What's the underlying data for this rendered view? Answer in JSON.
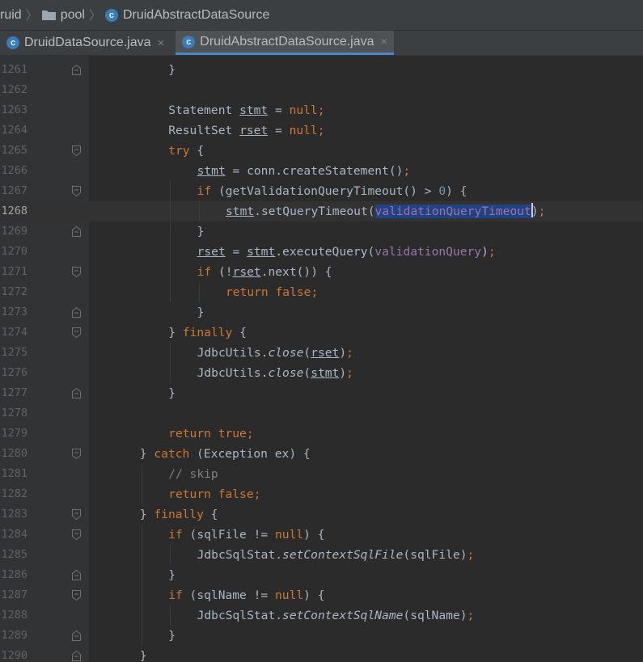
{
  "breadcrumb": [
    {
      "label": "ruid",
      "icon": null
    },
    {
      "label": "pool",
      "icon": "folder-icon"
    },
    {
      "label": "DruidAbstractDataSource",
      "icon": "class-icon"
    }
  ],
  "tabs": [
    {
      "label": "DruidDataSource.java",
      "active": false,
      "close": "×"
    },
    {
      "label": "DruidAbstractDataSource.java",
      "active": true,
      "close": "×"
    }
  ],
  "class_icon_letter": "c",
  "editor": {
    "current_line": "1268",
    "selected_text": "validationQueryTimeout",
    "lines": [
      {
        "n": "1261",
        "fold": "end",
        "indent": 3,
        "tokens": [
          [
            "}",
            ""
          ]
        ]
      },
      {
        "n": "1262",
        "fold": "",
        "indent": 0,
        "tokens": []
      },
      {
        "n": "1263",
        "fold": "",
        "indent": 3,
        "tokens": [
          [
            "Statement ",
            ""
          ],
          [
            "stmt",
            "ul"
          ],
          [
            " = ",
            ""
          ],
          [
            "null",
            "kw"
          ],
          [
            ";",
            "kw"
          ]
        ]
      },
      {
        "n": "1264",
        "fold": "",
        "indent": 3,
        "tokens": [
          [
            "ResultSet ",
            ""
          ],
          [
            "rset",
            "ul"
          ],
          [
            " = ",
            ""
          ],
          [
            "null",
            "kw"
          ],
          [
            ";",
            "kw"
          ]
        ]
      },
      {
        "n": "1265",
        "fold": "start",
        "indent": 3,
        "tokens": [
          [
            "try",
            "kw"
          ],
          [
            " {",
            ""
          ]
        ]
      },
      {
        "n": "1266",
        "fold": "",
        "indent": 4,
        "tokens": [
          [
            "stmt",
            "ul"
          ],
          [
            " = conn.createStatement()",
            ""
          ],
          [
            ";",
            "kw"
          ]
        ]
      },
      {
        "n": "1267",
        "fold": "start",
        "indent": 4,
        "tokens": [
          [
            "if",
            "kw"
          ],
          [
            " (getValidationQueryTimeout() > ",
            ""
          ],
          [
            "0",
            "num"
          ],
          [
            ") {",
            ""
          ]
        ]
      },
      {
        "n": "1268",
        "fold": "",
        "indent": 5,
        "tokens": [
          [
            "stmt",
            "ul"
          ],
          [
            ".setQueryTimeout(",
            ""
          ],
          [
            "validationQueryTimeout",
            "param sel"
          ],
          [
            "",
            "caret"
          ],
          [
            ")",
            ""
          ],
          [
            ";",
            "kw"
          ]
        ]
      },
      {
        "n": "1269",
        "fold": "end",
        "indent": 4,
        "tokens": [
          [
            "}",
            ""
          ]
        ]
      },
      {
        "n": "1270",
        "fold": "",
        "indent": 4,
        "tokens": [
          [
            "rset",
            "ul"
          ],
          [
            " = ",
            ""
          ],
          [
            "stmt",
            "ul"
          ],
          [
            ".executeQuery(",
            ""
          ],
          [
            "validationQuery",
            "param"
          ],
          [
            ")",
            ""
          ],
          [
            ";",
            "kw"
          ]
        ]
      },
      {
        "n": "1271",
        "fold": "start",
        "indent": 4,
        "tokens": [
          [
            "if",
            "kw"
          ],
          [
            " (!",
            ""
          ],
          [
            "rset",
            "ul"
          ],
          [
            ".next()) {",
            ""
          ]
        ]
      },
      {
        "n": "1272",
        "fold": "",
        "indent": 5,
        "tokens": [
          [
            "return false",
            "kw"
          ],
          [
            ";",
            "kw"
          ]
        ]
      },
      {
        "n": "1273",
        "fold": "end",
        "indent": 4,
        "tokens": [
          [
            "}",
            ""
          ]
        ]
      },
      {
        "n": "1274",
        "fold": "start",
        "indent": 3,
        "tokens": [
          [
            "} ",
            ""
          ],
          [
            "finally",
            "kw"
          ],
          [
            " {",
            ""
          ]
        ]
      },
      {
        "n": "1275",
        "fold": "",
        "indent": 4,
        "tokens": [
          [
            "JdbcUtils.",
            ""
          ],
          [
            "close",
            "it"
          ],
          [
            "(",
            ""
          ],
          [
            "rset",
            "ul"
          ],
          [
            ")",
            ""
          ],
          [
            ";",
            "kw"
          ]
        ]
      },
      {
        "n": "1276",
        "fold": "",
        "indent": 4,
        "tokens": [
          [
            "JdbcUtils.",
            ""
          ],
          [
            "close",
            "it"
          ],
          [
            "(",
            ""
          ],
          [
            "stmt",
            "ul"
          ],
          [
            ")",
            ""
          ],
          [
            ";",
            "kw"
          ]
        ]
      },
      {
        "n": "1277",
        "fold": "end",
        "indent": 3,
        "tokens": [
          [
            "}",
            ""
          ]
        ]
      },
      {
        "n": "1278",
        "fold": "",
        "indent": 0,
        "tokens": []
      },
      {
        "n": "1279",
        "fold": "",
        "indent": 3,
        "tokens": [
          [
            "return true",
            "kw"
          ],
          [
            ";",
            "kw"
          ]
        ]
      },
      {
        "n": "1280",
        "fold": "start",
        "indent": 2,
        "tokens": [
          [
            "} ",
            ""
          ],
          [
            "catch",
            "kw"
          ],
          [
            " (Exception ex) {",
            ""
          ]
        ]
      },
      {
        "n": "1281",
        "fold": "",
        "indent": 3,
        "tokens": [
          [
            "// skip",
            "cmt"
          ]
        ]
      },
      {
        "n": "1282",
        "fold": "",
        "indent": 3,
        "tokens": [
          [
            "return false",
            "kw"
          ],
          [
            ";",
            "kw"
          ]
        ]
      },
      {
        "n": "1283",
        "fold": "start",
        "indent": 2,
        "tokens": [
          [
            "} ",
            ""
          ],
          [
            "finally",
            "kw"
          ],
          [
            " {",
            ""
          ]
        ]
      },
      {
        "n": "1284",
        "fold": "start",
        "indent": 3,
        "tokens": [
          [
            "if",
            "kw"
          ],
          [
            " (sqlFile != ",
            ""
          ],
          [
            "null",
            "kw"
          ],
          [
            ") {",
            ""
          ]
        ]
      },
      {
        "n": "1285",
        "fold": "",
        "indent": 4,
        "tokens": [
          [
            "JdbcSqlStat.",
            ""
          ],
          [
            "setContextSqlFile",
            "it"
          ],
          [
            "(sqlFile)",
            ""
          ],
          [
            ";",
            "kw"
          ]
        ]
      },
      {
        "n": "1286",
        "fold": "end",
        "indent": 3,
        "tokens": [
          [
            "}",
            ""
          ]
        ]
      },
      {
        "n": "1287",
        "fold": "start",
        "indent": 3,
        "tokens": [
          [
            "if",
            "kw"
          ],
          [
            " (sqlName != ",
            ""
          ],
          [
            "null",
            "kw"
          ],
          [
            ") {",
            ""
          ]
        ]
      },
      {
        "n": "1288",
        "fold": "",
        "indent": 4,
        "tokens": [
          [
            "JdbcSqlStat.",
            ""
          ],
          [
            "setContextSqlName",
            "it"
          ],
          [
            "(sqlName)",
            ""
          ],
          [
            ";",
            "kw"
          ]
        ]
      },
      {
        "n": "1289",
        "fold": "end",
        "indent": 3,
        "tokens": [
          [
            "}",
            ""
          ]
        ]
      },
      {
        "n": "1290",
        "fold": "end",
        "indent": 2,
        "tokens": [
          [
            "}",
            ""
          ]
        ]
      }
    ]
  }
}
